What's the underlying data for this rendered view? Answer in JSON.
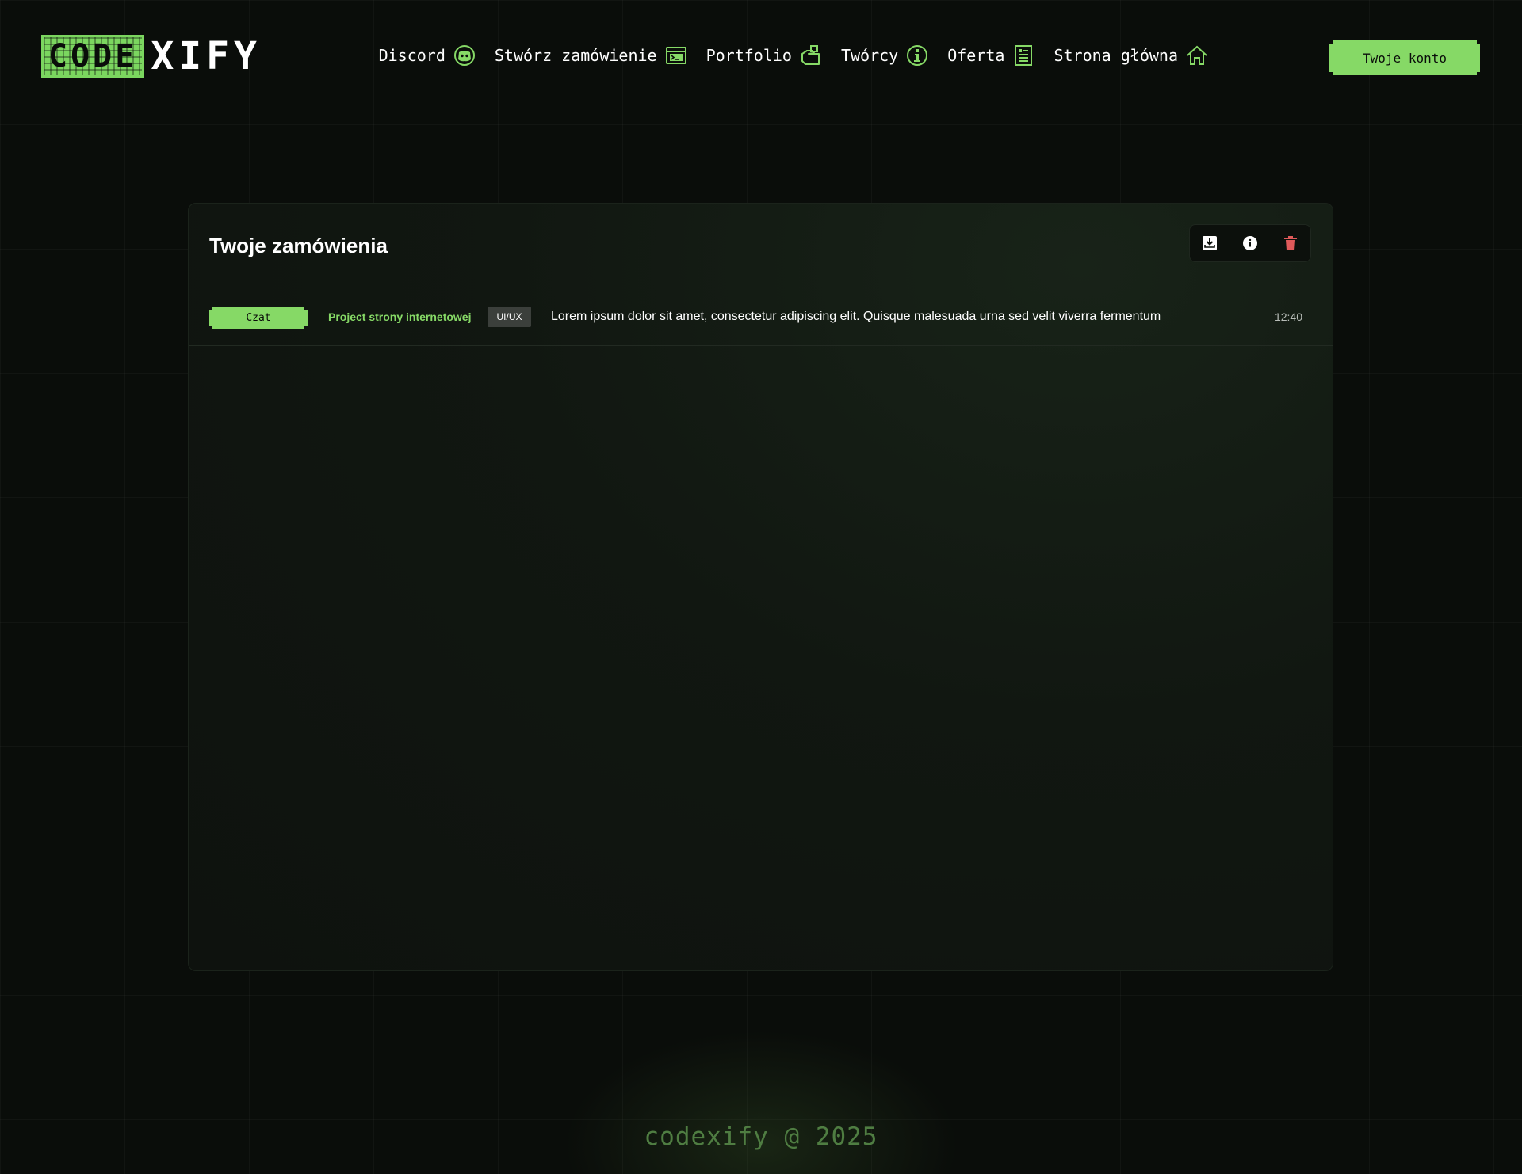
{
  "brand": {
    "logo_part1": "CODE",
    "logo_part2": "XIFY",
    "accent_color": "#86d966"
  },
  "nav": {
    "items": [
      {
        "label": "Discord",
        "icon": "discord-icon"
      },
      {
        "label": "Stwórz zamówienie",
        "icon": "browser-window-icon"
      },
      {
        "label": "Portfolio",
        "icon": "hand-icon"
      },
      {
        "label": "Twórcy",
        "icon": "info-icon"
      },
      {
        "label": "Oferta",
        "icon": "document-list-icon"
      },
      {
        "label": "Strona główna",
        "icon": "home-icon"
      }
    ],
    "account_label": "Twoje konto"
  },
  "orders": {
    "title": "Twoje zamówienia",
    "toolbar": [
      {
        "icon": "download-icon",
        "color": "#ffffff"
      },
      {
        "icon": "info-icon",
        "color": "#ffffff"
      },
      {
        "icon": "trash-icon",
        "color": "#e05a5a"
      }
    ],
    "rows": [
      {
        "chat_label": "Czat",
        "project": "Project strony internetowej",
        "tag": "UI/UX",
        "description": "Lorem ipsum dolor sit amet, consectetur adipiscing elit. Quisque malesuada urna sed velit viverra fermentum",
        "time": "12:40"
      }
    ]
  },
  "footer": {
    "text": "codexify @ 2025"
  }
}
